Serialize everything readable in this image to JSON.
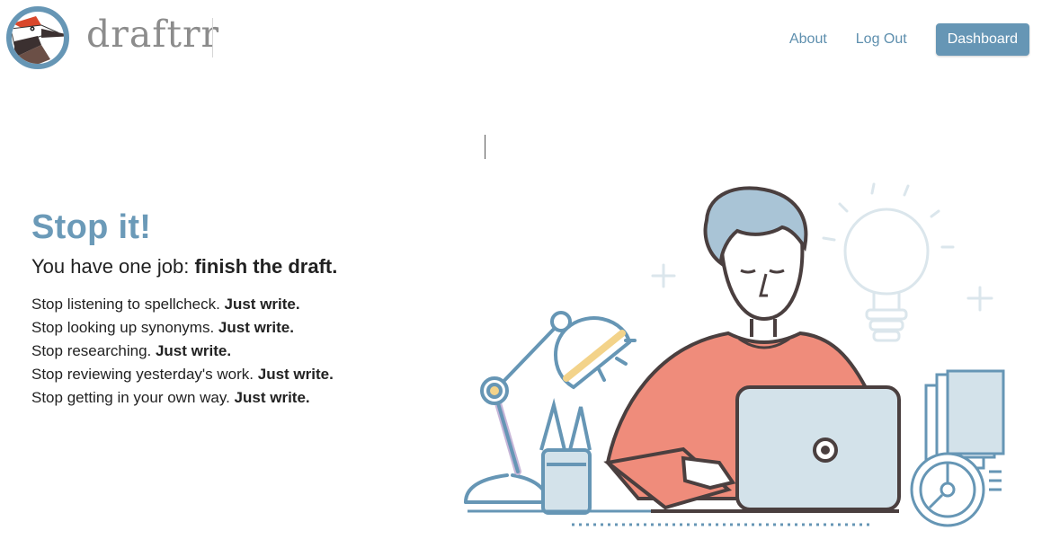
{
  "header": {
    "brand": "draftrr",
    "nav": {
      "about": "About",
      "logout": "Log Out",
      "dashboard": "Dashboard"
    }
  },
  "hero": {
    "title": "Stop it!",
    "subtitle_prefix": "You have one job: ",
    "subtitle_bold": "finish the draft.",
    "lines": [
      {
        "text": "Stop listening to spellcheck. ",
        "bold": "Just write."
      },
      {
        "text": "Stop looking up synonyms. ",
        "bold": "Just write."
      },
      {
        "text": "Stop researching. ",
        "bold": "Just write."
      },
      {
        "text": "Stop reviewing yesterday's work. ",
        "bold": "Just write."
      },
      {
        "text": "Stop getting in your own way. ",
        "bold": "Just write."
      }
    ]
  },
  "colors": {
    "accent": "#6b9ab8",
    "button": "#6696b5",
    "shirt": "#ef8c7b",
    "laptop": "#d3e2ea",
    "lamp_accent": "#f3d38a",
    "outline": "#4a3f3f"
  },
  "icons": [
    "woodpecker-logo-icon",
    "person-laptop-illustration",
    "desk-lamp-icon",
    "pencil-cup-icon",
    "light-bulb-icon",
    "clock-icon",
    "document-stack-icon"
  ]
}
